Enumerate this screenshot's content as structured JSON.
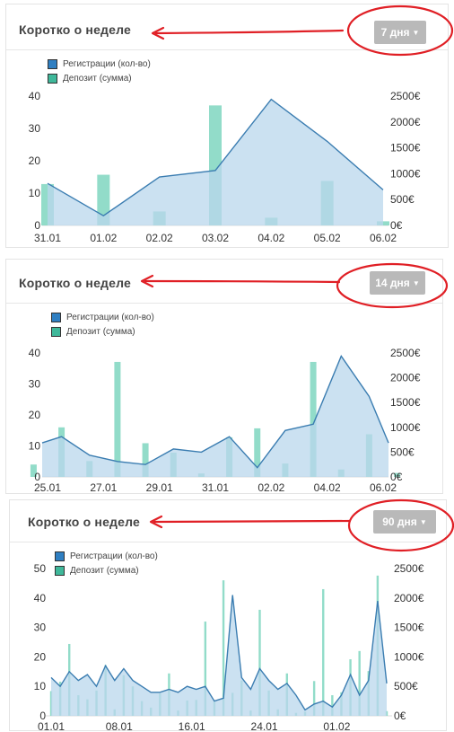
{
  "colors": {
    "registration_area": "#b9d7ec",
    "registration_line": "#3b7db1",
    "deposit_bar": "#7fd6bf",
    "deposit_bar_dark": "#47b9a0",
    "annotation": "#e01f25",
    "button_bg": "#b9b9b9"
  },
  "panels": [
    {
      "title": "Коротко о неделе",
      "period_button": "7 дня",
      "legend": [
        "Регистрации (кол-во)",
        "Депозит (сумма)"
      ],
      "chart_data": {
        "type": "area+bar",
        "x_ticks": [
          "31.01",
          "01.02",
          "02.02",
          "03.02",
          "04.02",
          "05.02",
          "06.02"
        ],
        "y_left_ticks": [
          "0",
          "10",
          "20",
          "30",
          "40"
        ],
        "y_right_ticks": [
          "0€",
          "500€",
          "1000€",
          "1500€",
          "2000€",
          "2500€"
        ],
        "y_left_range": [
          0,
          40
        ],
        "y_right_range": [
          0,
          2500
        ],
        "series": [
          {
            "name": "Регистрации (кол-во)",
            "kind": "area",
            "x": [
              0,
              1,
              2,
              3,
              4,
              5,
              6
            ],
            "values": [
              13,
              3,
              15,
              17,
              39,
              26,
              11
            ]
          },
          {
            "name": "Депозит (сумма)",
            "kind": "bar",
            "x": [
              0,
              1,
              2,
              3,
              4,
              5,
              6
            ],
            "values": [
              800,
              980,
              270,
              2320,
              150,
              860,
              80
            ]
          }
        ]
      }
    },
    {
      "title": "Коротко о неделе",
      "period_button": "14 дня",
      "legend": [
        "Регистрации (кол-во)",
        "Депозит (сумма)"
      ],
      "chart_data": {
        "type": "area+bar",
        "x_ticks": [
          "25.01",
          "27.01",
          "29.01",
          "31.01",
          "02.02",
          "04.02",
          "06.02"
        ],
        "y_left_ticks": [
          "0",
          "10",
          "20",
          "30",
          "40"
        ],
        "y_right_ticks": [
          "0€",
          "500€",
          "1000€",
          "1500€",
          "2000€",
          "2500€"
        ],
        "y_left_range": [
          0,
          40
        ],
        "y_right_range": [
          0,
          2500
        ],
        "series": [
          {
            "name": "Регистрации (кол-во)",
            "kind": "area",
            "x": [
              -0.5,
              0.5,
              1.5,
              2.5,
              3.5,
              4.5,
              5.5,
              6.5,
              7.5,
              8.5,
              9.5,
              10.5,
              11.5,
              12.5
            ],
            "values": [
              11,
              13,
              7,
              5,
              4,
              9,
              8,
              13,
              3,
              15,
              17,
              39,
              26,
              11
            ]
          },
          {
            "name": "Депозит (сумма)",
            "kind": "bar",
            "x": [
              -0.5,
              0.5,
              1.5,
              2.5,
              3.5,
              4.5,
              5.5,
              6.5,
              7.5,
              8.5,
              9.5,
              10.5,
              11.5,
              12.5
            ],
            "values": [
              250,
              1000,
              320,
              2320,
              680,
              490,
              70,
              800,
              980,
              270,
              2320,
              150,
              860,
              80
            ]
          }
        ]
      }
    },
    {
      "title": "Коротко о неделе",
      "period_button": "90 дня",
      "legend": [
        "Регистрации (кол-во)",
        "Депозит (сумма)"
      ],
      "chart_data": {
        "type": "area+bar",
        "x_ticks": [
          "01.01",
          "08.01",
          "16.01",
          "24.01",
          "01.02"
        ],
        "y_left_ticks": [
          "0",
          "10",
          "20",
          "30",
          "40",
          "50"
        ],
        "y_right_ticks": [
          "0€",
          "500€",
          "1000€",
          "1500€",
          "2000€",
          "2500€"
        ],
        "y_left_range": [
          0,
          50
        ],
        "y_right_range": [
          0,
          2500
        ],
        "series": [
          {
            "name": "Регистрации (кол-во)",
            "kind": "area",
            "x": [
              0,
              1,
              2,
              3,
              4,
              5,
              6,
              7,
              8,
              9,
              10,
              11,
              12,
              13,
              14,
              15,
              16,
              17,
              18,
              19,
              20,
              21,
              22,
              23,
              24,
              25,
              26,
              27,
              28,
              29,
              30,
              31,
              32,
              33,
              34,
              35,
              36,
              37
            ],
            "values": [
              13,
              10,
              15,
              12,
              14,
              10,
              17,
              12,
              16,
              12,
              10,
              8,
              8,
              9,
              8,
              10,
              9,
              10,
              5,
              6,
              41,
              13,
              9,
              16,
              12,
              9,
              11,
              7,
              2,
              4,
              5,
              3,
              7,
              14,
              7,
              12,
              39,
              11
            ]
          },
          {
            "name": "Депозит (сумма)",
            "kind": "bar",
            "x": [
              0,
              1,
              2,
              3,
              4,
              5,
              6,
              7,
              8,
              9,
              10,
              11,
              12,
              13,
              14,
              15,
              16,
              17,
              18,
              19,
              20,
              21,
              22,
              23,
              24,
              25,
              26,
              27,
              28,
              29,
              30,
              31,
              32,
              33,
              34,
              35,
              36,
              37
            ],
            "values": [
              420,
              580,
              1220,
              350,
              280,
              430,
              860,
              110,
              690,
              500,
              250,
              140,
              380,
              720,
              90,
              260,
              270,
              1600,
              240,
              2300,
              390,
              600,
              90,
              1800,
              430,
              110,
              720,
              50,
              70,
              590,
              2150,
              350,
              400,
              960,
              1100,
              760,
              2380,
              80
            ]
          }
        ]
      }
    }
  ]
}
